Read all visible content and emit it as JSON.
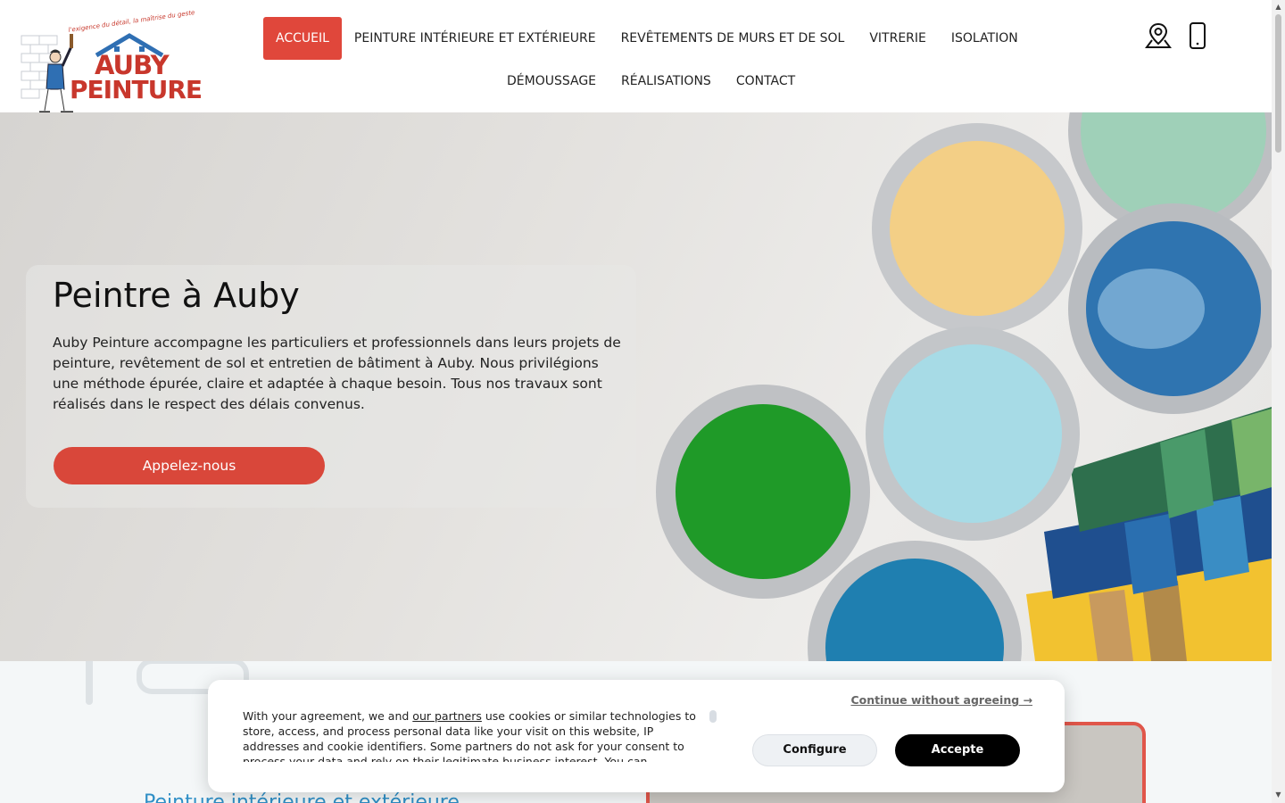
{
  "logo": {
    "tagline": "l'exigence du détail, la maîtrise du geste",
    "line1": "AUBY",
    "line2": "PEINTURE"
  },
  "nav": {
    "items": [
      {
        "label": "ACCUEIL",
        "active": true
      },
      {
        "label": "PEINTURE INTÉRIEURE ET EXTÉRIEURE",
        "active": false
      },
      {
        "label": "REVÊTEMENTS DE MURS ET DE SOL",
        "active": false
      },
      {
        "label": "VITRERIE",
        "active": false
      },
      {
        "label": "ISOLATION",
        "active": false
      },
      {
        "label": "DÉMOUSSAGE",
        "active": false
      },
      {
        "label": "RÉALISATIONS",
        "active": false
      },
      {
        "label": "CONTACT",
        "active": false
      }
    ]
  },
  "header_icons": [
    "location-pin-icon",
    "mobile-phone-icon"
  ],
  "hero": {
    "title": "Peintre à Auby",
    "text": "Auby Peinture accompagne les particuliers et professionnels dans leurs projets de peinture, revêtement de sol et entretien de bâtiment à Auby. Nous privilégions une méthode épurée, claire et adaptée à chaque besoin. Tous nos travaux sont réalisés dans le respect des délais convenus.",
    "button": "Appelez-nous"
  },
  "section": {
    "title": "Peinture intérieure et extérieure"
  },
  "cookie": {
    "continue": "Continue without agreeing →",
    "text_before": "With your agreement, we and ",
    "link": "our partners",
    "text_after": " use cookies or similar technologies to store, access, and process personal data like your visit on this website, IP addresses and cookie identifiers. Some partners do not ask for your consent to process your data and rely on their legitimate business interest. You can",
    "configure": "Configure",
    "accept": "Accepte"
  },
  "colors": {
    "accent": "#d9473a",
    "section_title": "#2f8fc6"
  }
}
